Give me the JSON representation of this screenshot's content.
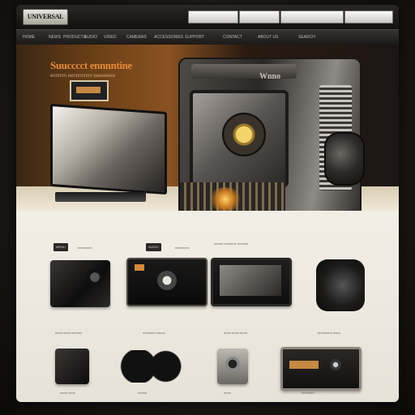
{
  "header": {
    "logo_text": "UNIVERSAL",
    "buttons": [
      "",
      "",
      "",
      ""
    ]
  },
  "nav": {
    "items": [
      "HOME",
      "NEWS",
      "PRODUCTS",
      "AUDIO",
      "VIDEO",
      "CAMERAS",
      "ACCESSORIES",
      "SUPPORT",
      "CONTACT",
      "ABOUT US",
      "SEARCH"
    ]
  },
  "hero": {
    "title": "Suucccct ennnntine",
    "subtitle": "ennnnn eennnnnnn eeeeeeee",
    "device_label": "Wnno"
  },
  "sections": [
    {
      "tag": "MENU",
      "text": "nnnnnnnn"
    },
    {
      "tag": "AUDIO",
      "text": "nnnnnnnn"
    },
    {
      "tag": "",
      "text": "eeeee nnnnnnn nnnnnn"
    }
  ],
  "captions": {
    "row1": [
      "nnnn nnnn nnnnnn",
      "nnnnnnn nnnnn",
      "nnnn nnnn nnnn",
      "nnnnnnnn nnnn"
    ],
    "row2": [
      "nnnn nnnn",
      "nnnnn",
      "nnnn",
      "nnnnnnn"
    ]
  }
}
